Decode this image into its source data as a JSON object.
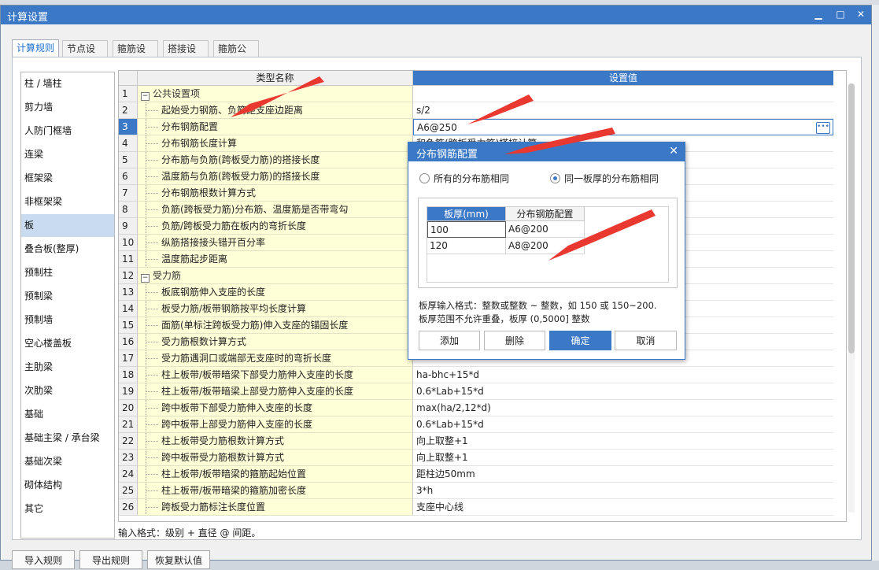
{
  "window": {
    "title": "计算设置",
    "min_icon": "minimize-icon",
    "max_icon": "maximize-icon",
    "close_icon": "close-icon"
  },
  "tabs": [
    "计算规则",
    "节点设置",
    "箍筋设置",
    "搭接设置",
    "箍筋公式"
  ],
  "active_tab": "计算规则",
  "sidebar": {
    "items": [
      "柱 / 墙柱",
      "剪力墙",
      "人防门框墙",
      "连梁",
      "框架梁",
      "非框架梁",
      "板",
      "叠合板(整厚)",
      "预制柱",
      "预制梁",
      "预制墙",
      "空心楼盖板",
      "主肋梁",
      "次肋梁",
      "基础",
      "基础主梁 / 承台梁",
      "基础次梁",
      "砌体结构",
      "其它"
    ],
    "selected": "板"
  },
  "grid": {
    "col_name": "类型名称",
    "col_value": "设置值",
    "rows": [
      {
        "num": "1",
        "name": "公共设置项",
        "value": "",
        "group": true
      },
      {
        "num": "2",
        "name": "起始受力钢筋、负筋距支座边距离",
        "value": "s/2"
      },
      {
        "num": "3",
        "name": "分布钢筋配置",
        "value": "A6@250",
        "selected": true
      },
      {
        "num": "4",
        "name": "分布钢筋长度计算",
        "value": "和负筋(跨板受力筋)搭接计算"
      },
      {
        "num": "5",
        "name": "分布筋与负筋(跨板受力筋)的搭接长度",
        "value": ""
      },
      {
        "num": "6",
        "name": "温度筋与负筋(跨板受力筋)的搭接长度",
        "value": ""
      },
      {
        "num": "7",
        "name": "分布钢筋根数计算方式",
        "value": ""
      },
      {
        "num": "8",
        "name": "负筋(跨板受力筋)分布筋、温度筋是否带弯勾",
        "value": ""
      },
      {
        "num": "9",
        "name": "负筋/跨板受力筋在板内的弯折长度",
        "value": ""
      },
      {
        "num": "10",
        "name": "纵筋搭接接头错开百分率",
        "value": ""
      },
      {
        "num": "11",
        "name": "温度筋起步距离",
        "value": ""
      },
      {
        "num": "12",
        "name": "受力筋",
        "value": "",
        "group": true
      },
      {
        "num": "13",
        "name": "板底钢筋伸入支座的长度",
        "value": ""
      },
      {
        "num": "14",
        "name": "板受力筋/板带钢筋按平均长度计算",
        "value": ""
      },
      {
        "num": "15",
        "name": "面筋(单标注跨板受力筋)伸入支座的锚固长度",
        "value": ""
      },
      {
        "num": "16",
        "name": "受力筋根数计算方式",
        "value": ""
      },
      {
        "num": "17",
        "name": "受力筋遇洞口或端部无支座时的弯折长度",
        "value": ""
      },
      {
        "num": "18",
        "name": "柱上板带/板带暗梁下部受力筋伸入支座的长度",
        "value": "ha-bhc+15*d"
      },
      {
        "num": "19",
        "name": "柱上板带/板带暗梁上部受力筋伸入支座的长度",
        "value": "0.6*Lab+15*d"
      },
      {
        "num": "20",
        "name": "跨中板带下部受力筋伸入支座的长度",
        "value": "max(ha/2,12*d)"
      },
      {
        "num": "21",
        "name": "跨中板带上部受力筋伸入支座的长度",
        "value": "0.6*Lab+15*d"
      },
      {
        "num": "22",
        "name": "柱上板带受力筋根数计算方式",
        "value": "向上取整+1"
      },
      {
        "num": "23",
        "name": "跨中板带受力筋根数计算方式",
        "value": "向上取整+1"
      },
      {
        "num": "24",
        "name": "柱上板带/板带暗梁的箍筋起始位置",
        "value": "距柱边50mm"
      },
      {
        "num": "25",
        "name": "柱上板带/板带暗梁的箍筋加密长度",
        "value": "3*h"
      },
      {
        "num": "26",
        "name": "跨板受力筋标注长度位置",
        "value": "支座中心线"
      }
    ]
  },
  "hint": "输入格式：级别 + 直径 @ 间距。",
  "bottom_buttons": [
    "导入规则",
    "导出规则",
    "恢复默认值"
  ],
  "dialog": {
    "title": "分布钢筋配置",
    "close_icon": "close-icon",
    "radio_all": "所有的分布筋相同",
    "radio_same": "同一板厚的分布筋相同",
    "radio_selected": "同一板厚的分布筋相同",
    "col_thickness": "板厚(mm)",
    "col_config": "分布钢筋配置",
    "rows": [
      {
        "thickness": "100",
        "config": "A6@200"
      },
      {
        "thickness": "120",
        "config": "A8@200"
      }
    ],
    "note1": "板厚输入格式：整数或整数 ~ 整数，如 150 或 150~200.",
    "note2": "板厚范围不允许重叠，板厚 (0,5000] 整数",
    "btn_add": "添加",
    "btn_delete": "删除",
    "btn_ok": "确定",
    "btn_cancel": "取消"
  },
  "colors": {
    "accent": "#3b78c6",
    "name_cell_bg": "#ffffd7",
    "annotation_arrow": "#e8382f"
  }
}
